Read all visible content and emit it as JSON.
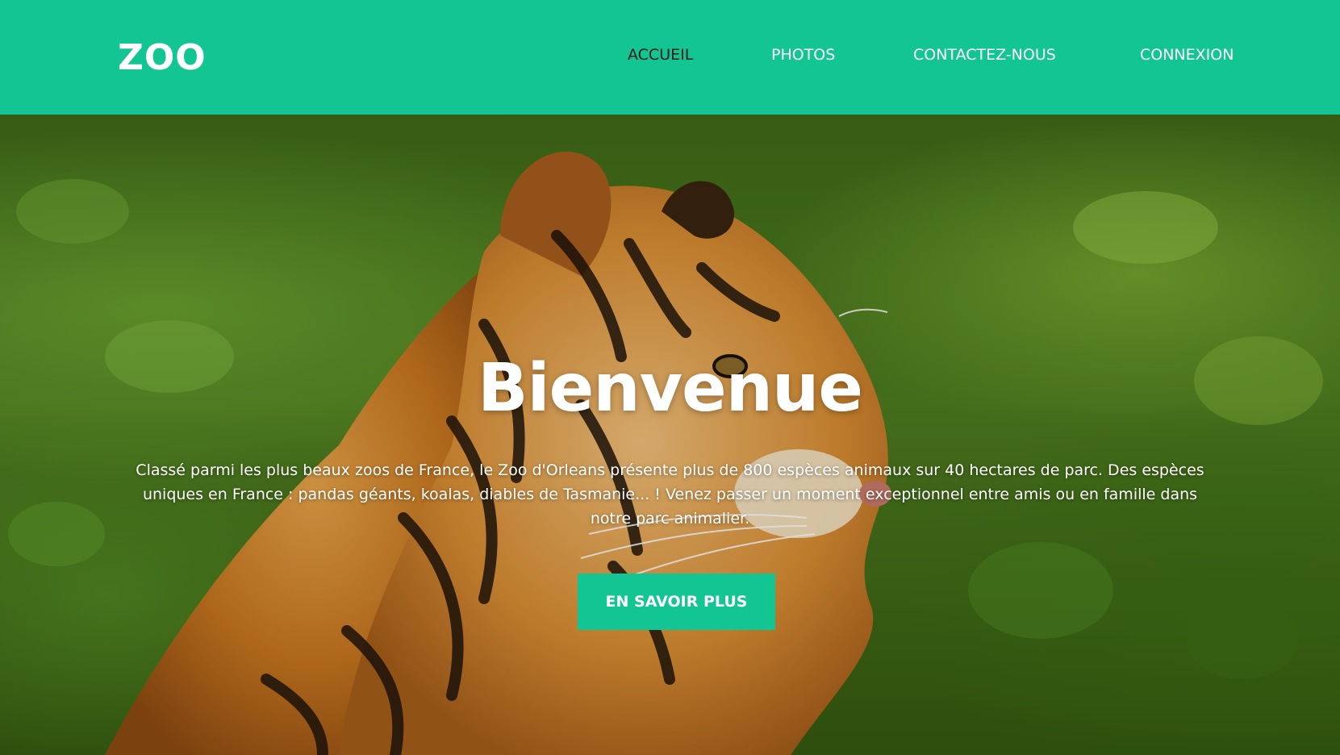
{
  "header": {
    "logo": "ZOO",
    "background_color": "#12c593",
    "nav": [
      {
        "label": "ACCUEIL",
        "active": true
      },
      {
        "label": "PHOTOS",
        "active": false
      },
      {
        "label": "CONTACTEZ-NOUS",
        "active": false
      },
      {
        "label": "CONNEXION",
        "active": false
      }
    ]
  },
  "hero": {
    "background_image": "tiger-in-jungle",
    "title": "Bienvenue",
    "description": "Classé parmi les plus beaux zoos de France, le Zoo d'Orleans présente plus de 800 espèces animaux sur 40 hectares de parc. Des espèces uniques en France : pandas géants, koalas, diables de Tasmanie... ! Venez passer un moment exceptionnel entre amis ou en famille dans notre parc animalier.",
    "button_label": "EN SAVOIR PLUS",
    "button_color": "#12c593"
  }
}
